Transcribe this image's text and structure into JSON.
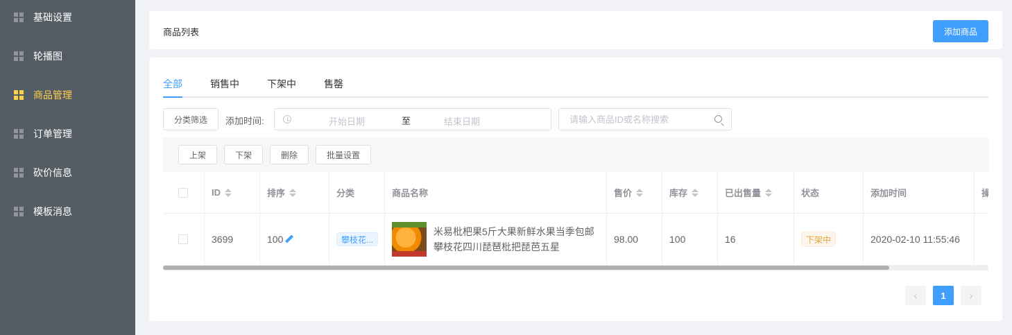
{
  "sidebar": {
    "items": [
      {
        "label": "基础设置"
      },
      {
        "label": "轮播图"
      },
      {
        "label": "商品管理",
        "active": true
      },
      {
        "label": "订单管理"
      },
      {
        "label": "砍价信息"
      },
      {
        "label": "模板消息"
      }
    ]
  },
  "header": {
    "title": "商品列表",
    "add_button": "添加商品"
  },
  "tabs": [
    "全部",
    "销售中",
    "下架中",
    "售罄"
  ],
  "filters": {
    "category_button": "分类筛选",
    "time_label": "添加时间:",
    "start_placeholder": "开始日期",
    "range_separator": "至",
    "end_placeholder": "结束日期",
    "search_placeholder": "请输入商品ID或名称搜索"
  },
  "toolbar": {
    "on_shelf": "上架",
    "off_shelf": "下架",
    "delete": "删除",
    "batch": "批量设置"
  },
  "table": {
    "columns": [
      "ID",
      "排序",
      "分类",
      "商品名称",
      "售价",
      "库存",
      "已出售量",
      "状态",
      "添加时间",
      "操"
    ],
    "rows": [
      {
        "id": "3699",
        "sort": "100",
        "category": "攀枝花...",
        "name": "米易枇杷果5斤大果新鲜水果当季包邮攀枝花四川琵琶枇把琵芭五星",
        "price": "98.00",
        "stock": "100",
        "sold": "16",
        "status": "下架中",
        "added": "2020-02-10 11:55:46"
      }
    ]
  },
  "pagination": {
    "prev": "‹",
    "current": "1",
    "next": "›"
  },
  "colors": {
    "sidebar_bg": "#545c64",
    "active": "#ffd04b",
    "primary": "#409eff",
    "warning": "#e6a23c"
  }
}
